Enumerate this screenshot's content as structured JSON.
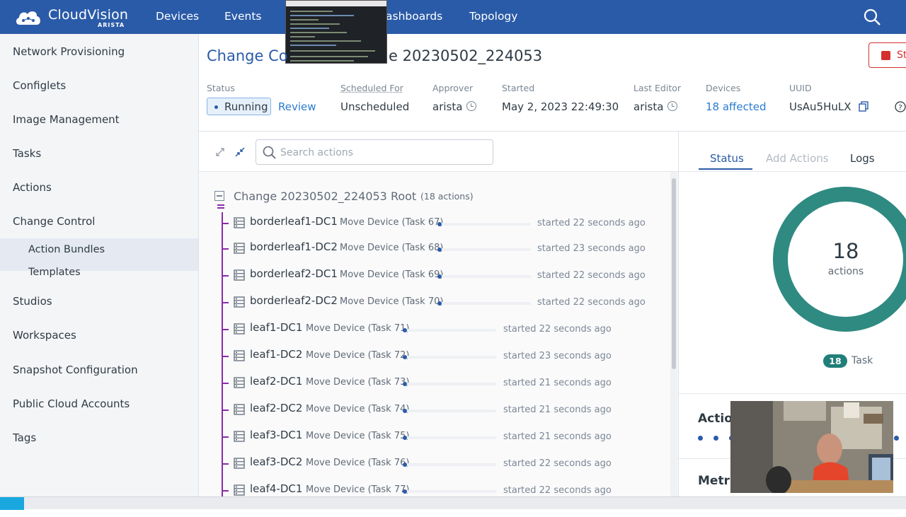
{
  "app": {
    "brand": "CloudVision",
    "brand_sub": "ARISTA"
  },
  "topnav": {
    "devices": "Devices",
    "events": "Events",
    "dashboards": "ashboards",
    "topology": "Topology"
  },
  "sidebar": {
    "items": [
      {
        "label": "Network Provisioning"
      },
      {
        "label": "Configlets"
      },
      {
        "label": "Image Management"
      },
      {
        "label": "Tasks"
      },
      {
        "label": "Actions"
      },
      {
        "label": "Change Control"
      },
      {
        "label": "Action Bundles"
      },
      {
        "label": "Templates"
      },
      {
        "label": "Studios"
      },
      {
        "label": "Workspaces"
      },
      {
        "label": "Snapshot Configuration"
      },
      {
        "label": "Public Cloud Accounts"
      },
      {
        "label": "Tags"
      }
    ]
  },
  "header": {
    "title_left": "Change Co",
    "title_right": "e 20230502_224053",
    "stop_label": "St"
  },
  "meta": {
    "status_label": "Status",
    "status_value": "Running",
    "review_link": "Review",
    "scheduled_label": "Scheduled For",
    "scheduled_value": "Unscheduled",
    "approver_label": "Approver",
    "approver_value": "arista",
    "started_label": "Started",
    "started_value": "May 2, 2023 22:49:30",
    "editor_label": "Last Editor",
    "editor_value": "arista",
    "devices_label": "Devices",
    "devices_value": "18 affected",
    "uuid_label": "UUID",
    "uuid_value": "UsAu5HuLX"
  },
  "search": {
    "placeholder": "Search actions"
  },
  "tree": {
    "root_title": "Change 20230502_224053 Root",
    "root_count": "(18 actions)",
    "rows": [
      {
        "name": "borderleaf1-DC1",
        "task": "Move Device (Task 67)",
        "when": "started 22 seconds ago"
      },
      {
        "name": "borderleaf1-DC2",
        "task": "Move Device (Task 68)",
        "when": "started 23 seconds ago"
      },
      {
        "name": "borderleaf2-DC1",
        "task": "Move Device (Task 69)",
        "when": "started 22 seconds ago"
      },
      {
        "name": "borderleaf2-DC2",
        "task": "Move Device (Task 70)",
        "when": "started 22 seconds ago"
      },
      {
        "name": "leaf1-DC1",
        "task": "Move Device (Task 71)",
        "when": "started 22 seconds ago"
      },
      {
        "name": "leaf1-DC2",
        "task": "Move Device (Task 72)",
        "when": "started 23 seconds ago"
      },
      {
        "name": "leaf2-DC1",
        "task": "Move Device (Task 73)",
        "when": "started 21 seconds ago"
      },
      {
        "name": "leaf2-DC2",
        "task": "Move Device (Task 74)",
        "when": "started 21 seconds ago"
      },
      {
        "name": "leaf3-DC1",
        "task": "Move Device (Task 75)",
        "when": "started 21 seconds ago"
      },
      {
        "name": "leaf3-DC2",
        "task": "Move Device (Task 76)",
        "when": "started 22 seconds ago"
      },
      {
        "name": "leaf4-DC1",
        "task": "Move Device (Task 77)",
        "when": "started 22 seconds ago"
      }
    ]
  },
  "right": {
    "tab_status": "Status",
    "tab_add": "Add Actions",
    "tab_logs": "Logs",
    "donut_number": "18",
    "donut_label": "actions",
    "task_count": "18",
    "task_label": "Task",
    "section_actions": "Action",
    "section_metrics": "Metric"
  },
  "colors": {
    "brand_blue": "#2a5ba8",
    "teal": "#217f7a",
    "tree_purple": "#8a2ba6",
    "stop_red": "#d32f2f"
  }
}
